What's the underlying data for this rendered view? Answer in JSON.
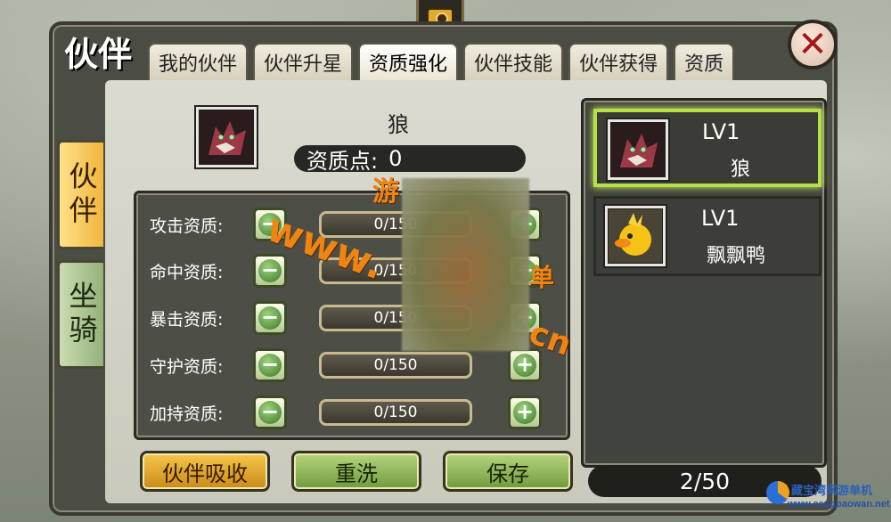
{
  "window": {
    "title": "伙伴",
    "close_symbol": "✕"
  },
  "tabs": [
    {
      "label": "我的伙伴",
      "active": false
    },
    {
      "label": "伙伴升星",
      "active": false
    },
    {
      "label": "资质强化",
      "active": true
    },
    {
      "label": "伙伴技能",
      "active": false
    },
    {
      "label": "伙伴获得",
      "active": false
    },
    {
      "label": "资质",
      "active": false
    }
  ],
  "side_tabs": {
    "partner": "伙伴",
    "mount": "坐骑"
  },
  "selected": {
    "name": "狼",
    "points_label": "资质点:",
    "points_value": "0",
    "icon": "wolf-portrait-icon"
  },
  "stats": [
    {
      "label": "攻击资质:",
      "value": "0/150"
    },
    {
      "label": "命中资质:",
      "value": "0/150"
    },
    {
      "label": "暴击资质:",
      "value": "0/150"
    },
    {
      "label": "守护资质:",
      "value": "0/150"
    },
    {
      "label": "加持资质:",
      "value": "0/150"
    }
  ],
  "stat_buttons": {
    "minus": "−",
    "plus": "+"
  },
  "actions": {
    "absorb": "伙伴吸收",
    "reroll": "重洗",
    "save": "保存"
  },
  "partners": [
    {
      "level": "LV1",
      "name": "狼",
      "icon": "wolf-portrait-icon",
      "selected": true
    },
    {
      "level": "LV1",
      "name": "飘飘鸭",
      "icon": "duck-portrait-icon",
      "selected": false
    }
  ],
  "partner_count": "2/50",
  "watermark": {
    "w1": "游",
    "w2": "www.",
    "w3": "单",
    "w4": "cn"
  },
  "site_logo": {
    "line1": "藏宝湾网游单机",
    "line2": "www.cangbaowan.net"
  },
  "colors": {
    "accent_selected": "#b6e04a",
    "button_gold": "#f0b63c",
    "button_green": "#8fb456"
  }
}
